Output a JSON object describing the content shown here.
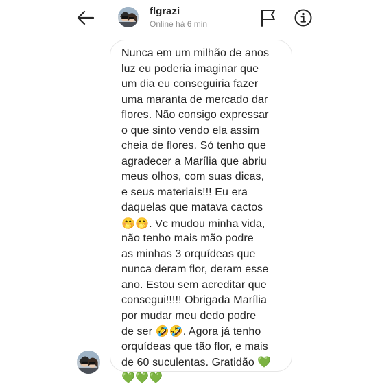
{
  "header": {
    "username": "flgrazi",
    "status": "Online há 6 min",
    "back_icon": "arrow-left-icon",
    "flag_icon": "flag-icon",
    "info_icon": "info-icon"
  },
  "message": {
    "lines": [
      "Nunca em um milhão de anos",
      "luz eu poderia imaginar que",
      "um dia eu conseguiria fazer",
      "uma maranta de mercado dar",
      "flores. Não  consigo expressar",
      "o que sinto vendo ela assim",
      "cheia de flores. Só  tenho que",
      "agradecer a Marília que abriu",
      "meus olhos, com suas dicas,",
      "e seus materiais!!! Eu era",
      "daquelas que matava cactos",
      ". Vc mudou minha vida,",
      "não  tenho mais  mão podre",
      "as minhas 3 orquídeas que",
      "nunca deram flor, deram esse",
      "ano. Estou sem acreditar que",
      "consegui!!!!! Obrigada Marília",
      "por mudar meu dedo podre",
      "de ser",
      ". Agora já  tenho",
      "orquídeas que tão flor, e mais",
      "de 60 suculentas.  Gratidão"
    ],
    "emoji_hug": "🤭",
    "emoji_rofl": "🤣",
    "emoji_heart": "💚"
  },
  "colors": {
    "text": "#262626",
    "muted": "#8e8e8e",
    "bubble_border": "#e6e6e6",
    "heart": "#6ab04c"
  }
}
